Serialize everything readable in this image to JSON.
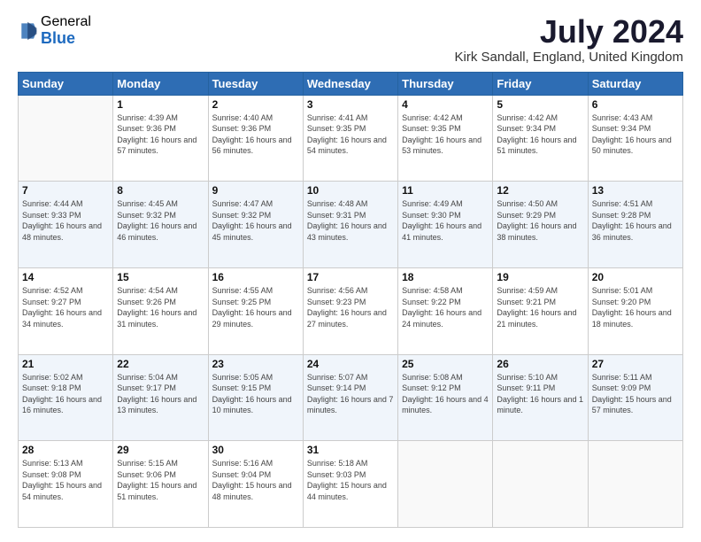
{
  "logo": {
    "general": "General",
    "blue": "Blue"
  },
  "header": {
    "title": "July 2024",
    "subtitle": "Kirk Sandall, England, United Kingdom"
  },
  "columns": [
    "Sunday",
    "Monday",
    "Tuesday",
    "Wednesday",
    "Thursday",
    "Friday",
    "Saturday"
  ],
  "weeks": [
    [
      {
        "day": "",
        "sunrise": "",
        "sunset": "",
        "daylight": ""
      },
      {
        "day": "1",
        "sunrise": "Sunrise: 4:39 AM",
        "sunset": "Sunset: 9:36 PM",
        "daylight": "Daylight: 16 hours and 57 minutes."
      },
      {
        "day": "2",
        "sunrise": "Sunrise: 4:40 AM",
        "sunset": "Sunset: 9:36 PM",
        "daylight": "Daylight: 16 hours and 56 minutes."
      },
      {
        "day": "3",
        "sunrise": "Sunrise: 4:41 AM",
        "sunset": "Sunset: 9:35 PM",
        "daylight": "Daylight: 16 hours and 54 minutes."
      },
      {
        "day": "4",
        "sunrise": "Sunrise: 4:42 AM",
        "sunset": "Sunset: 9:35 PM",
        "daylight": "Daylight: 16 hours and 53 minutes."
      },
      {
        "day": "5",
        "sunrise": "Sunrise: 4:42 AM",
        "sunset": "Sunset: 9:34 PM",
        "daylight": "Daylight: 16 hours and 51 minutes."
      },
      {
        "day": "6",
        "sunrise": "Sunrise: 4:43 AM",
        "sunset": "Sunset: 9:34 PM",
        "daylight": "Daylight: 16 hours and 50 minutes."
      }
    ],
    [
      {
        "day": "7",
        "sunrise": "Sunrise: 4:44 AM",
        "sunset": "Sunset: 9:33 PM",
        "daylight": "Daylight: 16 hours and 48 minutes."
      },
      {
        "day": "8",
        "sunrise": "Sunrise: 4:45 AM",
        "sunset": "Sunset: 9:32 PM",
        "daylight": "Daylight: 16 hours and 46 minutes."
      },
      {
        "day": "9",
        "sunrise": "Sunrise: 4:47 AM",
        "sunset": "Sunset: 9:32 PM",
        "daylight": "Daylight: 16 hours and 45 minutes."
      },
      {
        "day": "10",
        "sunrise": "Sunrise: 4:48 AM",
        "sunset": "Sunset: 9:31 PM",
        "daylight": "Daylight: 16 hours and 43 minutes."
      },
      {
        "day": "11",
        "sunrise": "Sunrise: 4:49 AM",
        "sunset": "Sunset: 9:30 PM",
        "daylight": "Daylight: 16 hours and 41 minutes."
      },
      {
        "day": "12",
        "sunrise": "Sunrise: 4:50 AM",
        "sunset": "Sunset: 9:29 PM",
        "daylight": "Daylight: 16 hours and 38 minutes."
      },
      {
        "day": "13",
        "sunrise": "Sunrise: 4:51 AM",
        "sunset": "Sunset: 9:28 PM",
        "daylight": "Daylight: 16 hours and 36 minutes."
      }
    ],
    [
      {
        "day": "14",
        "sunrise": "Sunrise: 4:52 AM",
        "sunset": "Sunset: 9:27 PM",
        "daylight": "Daylight: 16 hours and 34 minutes."
      },
      {
        "day": "15",
        "sunrise": "Sunrise: 4:54 AM",
        "sunset": "Sunset: 9:26 PM",
        "daylight": "Daylight: 16 hours and 31 minutes."
      },
      {
        "day": "16",
        "sunrise": "Sunrise: 4:55 AM",
        "sunset": "Sunset: 9:25 PM",
        "daylight": "Daylight: 16 hours and 29 minutes."
      },
      {
        "day": "17",
        "sunrise": "Sunrise: 4:56 AM",
        "sunset": "Sunset: 9:23 PM",
        "daylight": "Daylight: 16 hours and 27 minutes."
      },
      {
        "day": "18",
        "sunrise": "Sunrise: 4:58 AM",
        "sunset": "Sunset: 9:22 PM",
        "daylight": "Daylight: 16 hours and 24 minutes."
      },
      {
        "day": "19",
        "sunrise": "Sunrise: 4:59 AM",
        "sunset": "Sunset: 9:21 PM",
        "daylight": "Daylight: 16 hours and 21 minutes."
      },
      {
        "day": "20",
        "sunrise": "Sunrise: 5:01 AM",
        "sunset": "Sunset: 9:20 PM",
        "daylight": "Daylight: 16 hours and 18 minutes."
      }
    ],
    [
      {
        "day": "21",
        "sunrise": "Sunrise: 5:02 AM",
        "sunset": "Sunset: 9:18 PM",
        "daylight": "Daylight: 16 hours and 16 minutes."
      },
      {
        "day": "22",
        "sunrise": "Sunrise: 5:04 AM",
        "sunset": "Sunset: 9:17 PM",
        "daylight": "Daylight: 16 hours and 13 minutes."
      },
      {
        "day": "23",
        "sunrise": "Sunrise: 5:05 AM",
        "sunset": "Sunset: 9:15 PM",
        "daylight": "Daylight: 16 hours and 10 minutes."
      },
      {
        "day": "24",
        "sunrise": "Sunrise: 5:07 AM",
        "sunset": "Sunset: 9:14 PM",
        "daylight": "Daylight: 16 hours and 7 minutes."
      },
      {
        "day": "25",
        "sunrise": "Sunrise: 5:08 AM",
        "sunset": "Sunset: 9:12 PM",
        "daylight": "Daylight: 16 hours and 4 minutes."
      },
      {
        "day": "26",
        "sunrise": "Sunrise: 5:10 AM",
        "sunset": "Sunset: 9:11 PM",
        "daylight": "Daylight: 16 hours and 1 minute."
      },
      {
        "day": "27",
        "sunrise": "Sunrise: 5:11 AM",
        "sunset": "Sunset: 9:09 PM",
        "daylight": "Daylight: 15 hours and 57 minutes."
      }
    ],
    [
      {
        "day": "28",
        "sunrise": "Sunrise: 5:13 AM",
        "sunset": "Sunset: 9:08 PM",
        "daylight": "Daylight: 15 hours and 54 minutes."
      },
      {
        "day": "29",
        "sunrise": "Sunrise: 5:15 AM",
        "sunset": "Sunset: 9:06 PM",
        "daylight": "Daylight: 15 hours and 51 minutes."
      },
      {
        "day": "30",
        "sunrise": "Sunrise: 5:16 AM",
        "sunset": "Sunset: 9:04 PM",
        "daylight": "Daylight: 15 hours and 48 minutes."
      },
      {
        "day": "31",
        "sunrise": "Sunrise: 5:18 AM",
        "sunset": "Sunset: 9:03 PM",
        "daylight": "Daylight: 15 hours and 44 minutes."
      },
      {
        "day": "",
        "sunrise": "",
        "sunset": "",
        "daylight": ""
      },
      {
        "day": "",
        "sunrise": "",
        "sunset": "",
        "daylight": ""
      },
      {
        "day": "",
        "sunrise": "",
        "sunset": "",
        "daylight": ""
      }
    ]
  ]
}
